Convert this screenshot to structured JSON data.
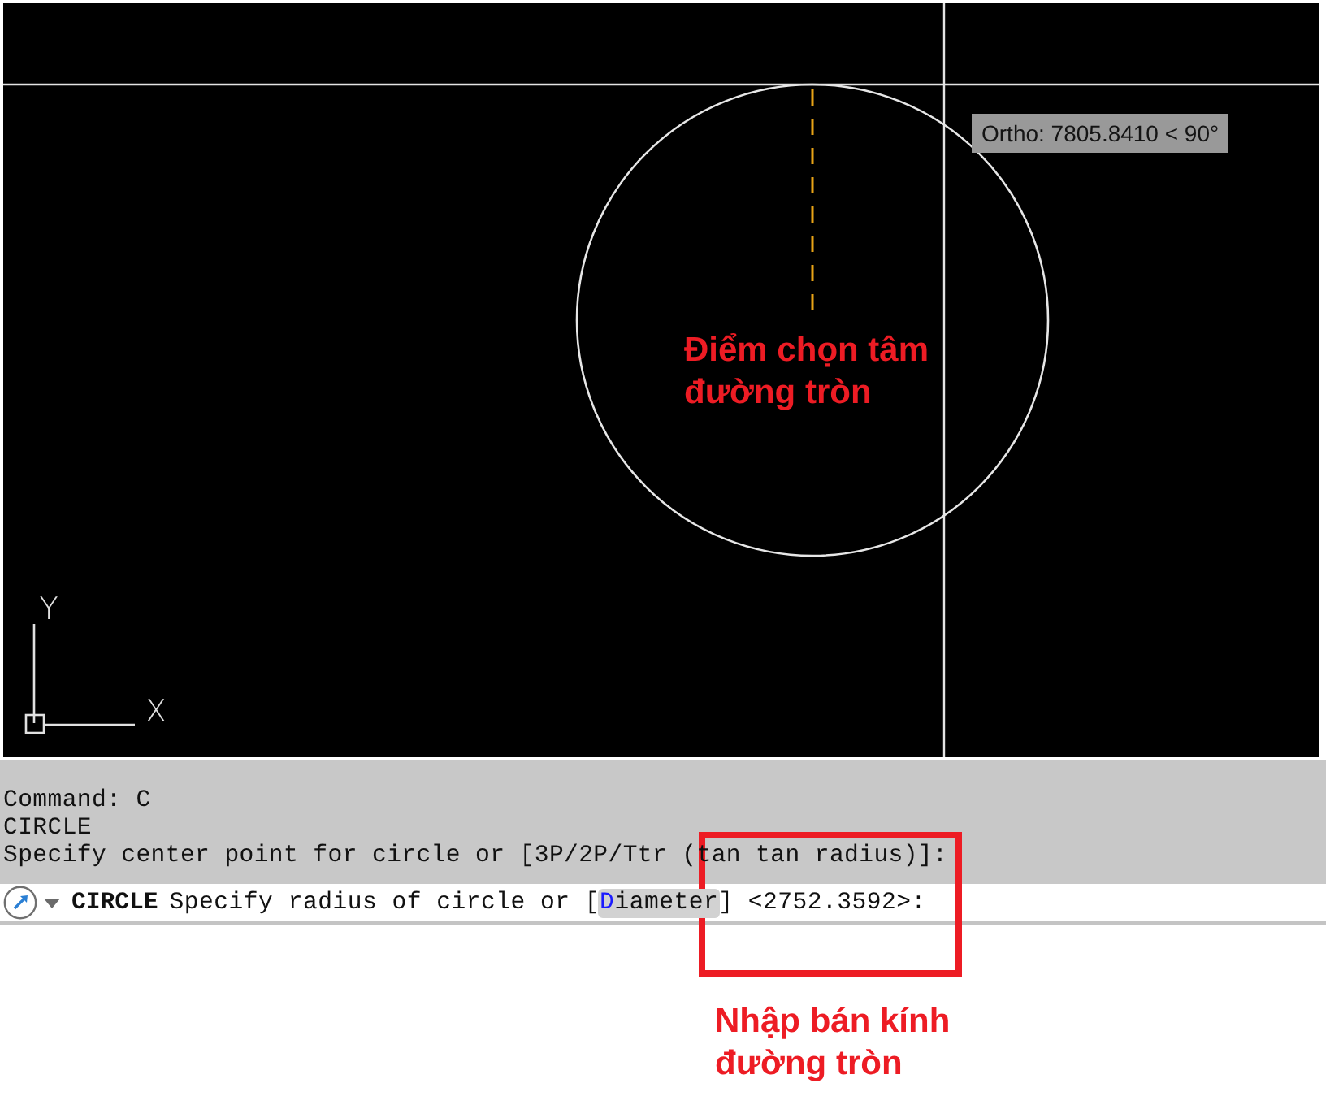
{
  "drawing_area": {
    "tooltip": "Ortho: 7805.8410 < 90°",
    "ucs_icon": {
      "y_label": "Y",
      "x_label": "X"
    }
  },
  "command_window": {
    "history": [
      "Command: C",
      "CIRCLE",
      "Specify center point for circle or [3P/2P/Ttr (tan tan radius)]:"
    ],
    "prompt": {
      "command": "CIRCLE",
      "text": "Specify radius of circle or [",
      "options": [
        {
          "hotkey": "D",
          "rest": "iameter",
          "selected": true
        }
      ],
      "suffix": "] <2752.3592>:"
    }
  },
  "annotations": [
    {
      "kind": "label",
      "text": "Điểm chọn tâm đường tròn"
    },
    {
      "kind": "frame"
    },
    {
      "kind": "label",
      "text": "Nhập bán kính đường tròn"
    }
  ]
}
